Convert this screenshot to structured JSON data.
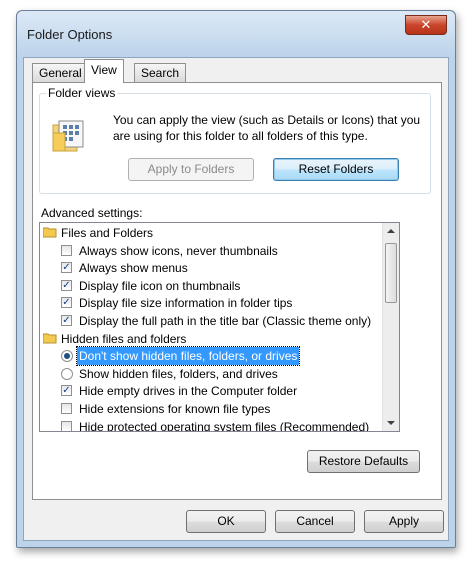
{
  "window": {
    "title": "Folder Options",
    "close_symbol": "✕"
  },
  "tabs": [
    {
      "label": "General",
      "active": false
    },
    {
      "label": "View",
      "active": true
    },
    {
      "label": "Search",
      "active": false
    }
  ],
  "folder_views": {
    "label": "Folder views",
    "description": "You can apply the view (such as Details or Icons) that you are using for this folder to all folders of this type.",
    "apply_label": "Apply to Folders",
    "reset_label": "Reset Folders"
  },
  "advanced": {
    "label": "Advanced settings:",
    "items": [
      {
        "type": "folder",
        "label": "Files and Folders",
        "checked": null
      },
      {
        "type": "checkbox",
        "label": "Always show icons, never thumbnails",
        "checked": false
      },
      {
        "type": "checkbox",
        "label": "Always show menus",
        "checked": true
      },
      {
        "type": "checkbox",
        "label": "Display file icon on thumbnails",
        "checked": true
      },
      {
        "type": "checkbox",
        "label": "Display file size information in folder tips",
        "checked": true
      },
      {
        "type": "checkbox",
        "label": "Display the full path in the title bar (Classic theme only)",
        "checked": true
      },
      {
        "type": "folder",
        "label": "Hidden files and folders",
        "checked": null
      },
      {
        "type": "radio",
        "label": "Don't show hidden files, folders, or drives",
        "checked": true,
        "selected": true
      },
      {
        "type": "radio",
        "label": "Show hidden files, folders, and drives",
        "checked": false
      },
      {
        "type": "checkbox",
        "label": "Hide empty drives in the Computer folder",
        "checked": true
      },
      {
        "type": "checkbox",
        "label": "Hide extensions for known file types",
        "checked": false
      },
      {
        "type": "checkbox",
        "label": "Hide protected operating system files (Recommended)",
        "checked": false
      }
    ],
    "check_mark": "✓"
  },
  "buttons": {
    "restore_defaults": "Restore Defaults",
    "ok": "OK",
    "cancel": "Cancel",
    "apply": "Apply"
  },
  "colors": {
    "selection": "#3399ff",
    "window_frame": "#bcd3ea",
    "close_button": "#c9452a"
  }
}
